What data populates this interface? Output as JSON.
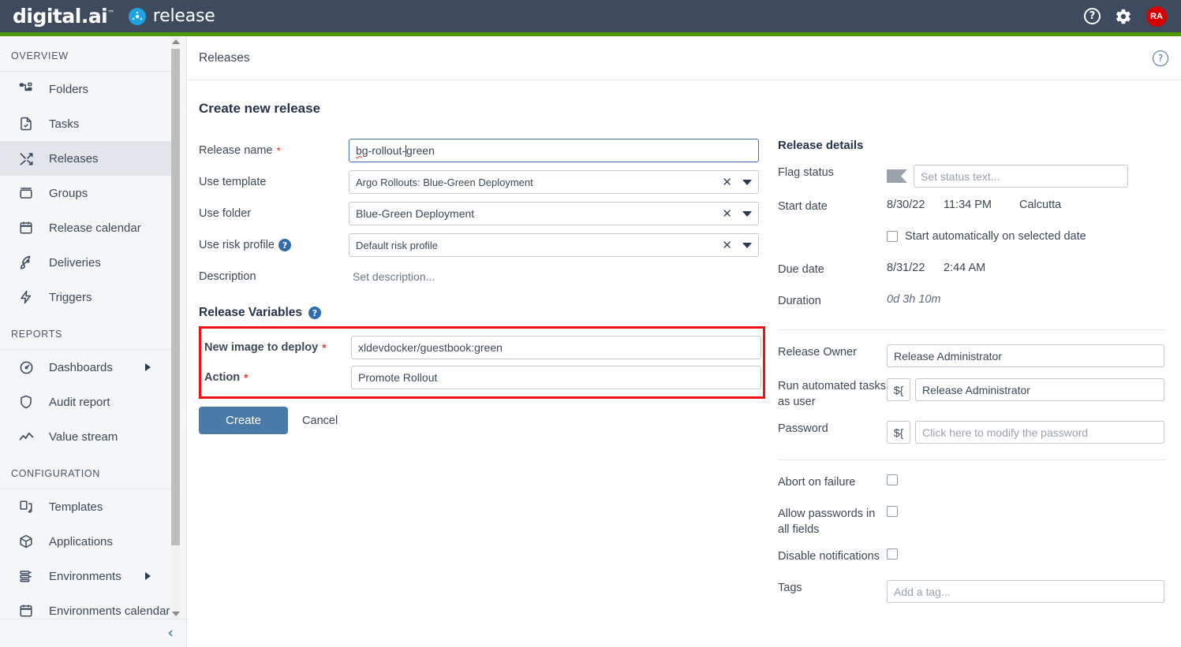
{
  "topbar": {
    "brand_primary": "digital.ai",
    "brand_tm": "™",
    "brand_secondary": "release",
    "help_icon": "?",
    "gear_icon": "gear-icon",
    "avatar_initials": "RA",
    "accent_color": "#4e9a06",
    "background_color": "#3e4b5e"
  },
  "sidebar": {
    "sections": [
      {
        "label": "OVERVIEW",
        "items": [
          {
            "label": "Folders",
            "icon": "folders-icon",
            "active": false,
            "arrow": false
          },
          {
            "label": "Tasks",
            "icon": "tasks-icon",
            "active": false,
            "arrow": false
          },
          {
            "label": "Releases",
            "icon": "releases-icon",
            "active": true,
            "arrow": false
          },
          {
            "label": "Groups",
            "icon": "groups-icon",
            "active": false,
            "arrow": false
          },
          {
            "label": "Release calendar",
            "icon": "calendar-icon",
            "active": false,
            "arrow": false
          },
          {
            "label": "Deliveries",
            "icon": "rocket-icon",
            "active": false,
            "arrow": false
          },
          {
            "label": "Triggers",
            "icon": "lightning-icon",
            "active": false,
            "arrow": false
          }
        ]
      },
      {
        "label": "REPORTS",
        "items": [
          {
            "label": "Dashboards",
            "icon": "dashboard-gauge-icon",
            "active": false,
            "arrow": true
          },
          {
            "label": "Audit report",
            "icon": "shield-icon",
            "active": false,
            "arrow": false
          },
          {
            "label": "Value stream",
            "icon": "trend-line-icon",
            "active": false,
            "arrow": false
          }
        ]
      },
      {
        "label": "CONFIGURATION",
        "items": [
          {
            "label": "Templates",
            "icon": "templates-icon",
            "active": false,
            "arrow": false
          },
          {
            "label": "Applications",
            "icon": "box-3d-icon",
            "active": false,
            "arrow": false
          },
          {
            "label": "Environments",
            "icon": "environments-icon",
            "active": false,
            "arrow": true
          },
          {
            "label": "Environments calendar",
            "icon": "calendar-icon",
            "active": false,
            "arrow": false
          }
        ]
      }
    ],
    "collapse_icon": "‹"
  },
  "content": {
    "breadcrumb": "Releases",
    "help_icon": "?",
    "page_title": "Create new release",
    "form": {
      "release_name": {
        "label": "Release name",
        "required": "*",
        "value_prefix": "bg",
        "value_suffix": "-rollout-",
        "value_tail": "green",
        "value": "bg-rollout-green"
      },
      "use_template": {
        "label": "Use template",
        "value": "Argo Rollouts: Blue-Green Deployment",
        "clear_icon": "✕",
        "dropdown_icon": "chevron-down-icon"
      },
      "use_folder": {
        "label": "Use folder",
        "value": "Blue-Green Deployment",
        "clear_icon": "✕",
        "dropdown_icon": "chevron-down-icon"
      },
      "use_risk_profile": {
        "label": "Use risk profile",
        "help_icon": "?",
        "value": "Default risk profile",
        "clear_icon": "✕",
        "dropdown_icon": "chevron-down-icon"
      },
      "description": {
        "label": "Description",
        "placeholder": "Set description..."
      }
    },
    "release_variables": {
      "title": "Release Variables",
      "help_icon": "?",
      "highlight_color": "#ee1111",
      "fields": [
        {
          "label": "New image to deploy",
          "required": "*",
          "value": "xldevdocker/guestbook:green"
        },
        {
          "label": "Action",
          "required": "*",
          "value": "Promote Rollout"
        }
      ]
    },
    "actions": {
      "create_label": "Create",
      "cancel_label": "Cancel",
      "create_color": "#4a7aa7"
    }
  },
  "release_details": {
    "title": "Release details",
    "flag_status": {
      "label": "Flag status",
      "icon": "flag-icon",
      "placeholder": "Set status text..."
    },
    "start_date": {
      "label": "Start date",
      "date": "8/30/22",
      "time": "11:34 PM",
      "timezone": "Calcutta"
    },
    "start_auto": {
      "label": "Start automatically on selected date",
      "checked": false
    },
    "due_date": {
      "label": "Due date",
      "date": "8/31/22",
      "time": "2:44 AM"
    },
    "duration": {
      "label": "Duration",
      "value": "0d 3h 10m"
    },
    "release_owner": {
      "label": "Release Owner",
      "value": "Release Administrator"
    },
    "run_as_user": {
      "label": "Run automated tasks as user",
      "var_prefix": "${",
      "value": "Release Administrator"
    },
    "password": {
      "label": "Password",
      "var_prefix": "${",
      "placeholder": "Click here to modify the password"
    },
    "abort_on_failure": {
      "label": "Abort on failure",
      "checked": false
    },
    "allow_passwords": {
      "label": "Allow passwords in all fields",
      "checked": false
    },
    "disable_notifications": {
      "label": "Disable notifications",
      "checked": false
    },
    "tags": {
      "label": "Tags",
      "placeholder": "Add a tag..."
    }
  }
}
